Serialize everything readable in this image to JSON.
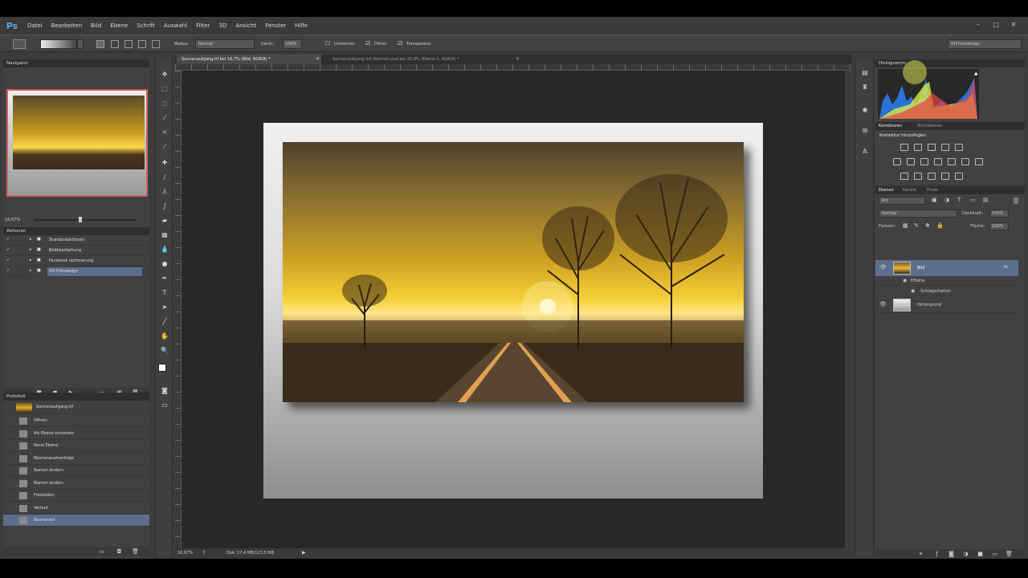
{
  "app": {
    "logo": "Ps"
  },
  "menu": [
    "Datei",
    "Bearbeiten",
    "Bild",
    "Ebene",
    "Schrift",
    "Auswahl",
    "Filter",
    "3D",
    "Ansicht",
    "Fenster",
    "Hilfe"
  ],
  "options": {
    "mode_label": "Modus:",
    "mode_value": "Normal",
    "opacity_label": "Deckr.:",
    "opacity_value": "100%",
    "reverse_label": "Umkehren",
    "dither_label": "Dither",
    "transparency_label": "Transparenz",
    "workspace": "RH-Fotodesign"
  },
  "tabs": [
    {
      "label": "Sonnenaufgang.tif bei 16,7% (Bild, RGB/8) *",
      "active": true
    },
    {
      "label": "Sonnenaufgang mit Rahmen.psd bei 25,8% (Ebene 1, RGB/8) *",
      "active": false
    }
  ],
  "navigator": {
    "title": "Navigator",
    "zoom": "16,67%"
  },
  "actions": {
    "title": "Aktionen",
    "items": [
      {
        "label": "Standardaktionen",
        "selected": false
      },
      {
        "label": "Bildbearbeitung",
        "selected": false
      },
      {
        "label": "Facebook optimierung",
        "selected": false
      },
      {
        "label": "RH-Fotodesign",
        "selected": true
      }
    ]
  },
  "history": {
    "title": "Protokoll",
    "snapshot": "Sonnenaufgang.tif",
    "items": [
      {
        "label": "Öffnen",
        "selected": false
      },
      {
        "label": "Als Ebene einsetzen",
        "selected": false
      },
      {
        "label": "Neue Ebene",
        "selected": false
      },
      {
        "label": "Ebeneneuehenfolge",
        "selected": false
      },
      {
        "label": "Namen ändern",
        "selected": false
      },
      {
        "label": "Namen ändern",
        "selected": false
      },
      {
        "label": "Freistellen",
        "selected": false
      },
      {
        "label": "Verlauf",
        "selected": false
      },
      {
        "label": "Ebenenstil",
        "selected": true
      }
    ]
  },
  "status": {
    "zoom": "16,67%",
    "doc": "Dok: 17,4 MB/123,5 MB"
  },
  "histogram": {
    "title": "Histogramm"
  },
  "adjustments": {
    "tabs": [
      "Korrekturen",
      "Stile/ebenen"
    ],
    "heading": "Korrektur hinzufügen"
  },
  "layers": {
    "tabs": [
      "Ebenen",
      "Kanäle",
      "Pfade"
    ],
    "filter": "Art",
    "blend_mode": "Normal",
    "opacity_label": "Deckkraft:",
    "opacity_value": "100%",
    "lock_label": "Fixieren:",
    "fill_label": "Fläche:",
    "fill_value": "100%",
    "items": [
      {
        "name": "Bild",
        "fx": "fx",
        "selected": true
      },
      {
        "name": "Effekte",
        "selected": false
      },
      {
        "name": "Schlagschatten",
        "selected": false
      },
      {
        "name": "Hintergrund",
        "selected": false
      }
    ]
  },
  "colors": {
    "accent_selection": "#5b6e8c",
    "ui_bg": "#3c3c3c",
    "canvas_bg": "#282828"
  }
}
